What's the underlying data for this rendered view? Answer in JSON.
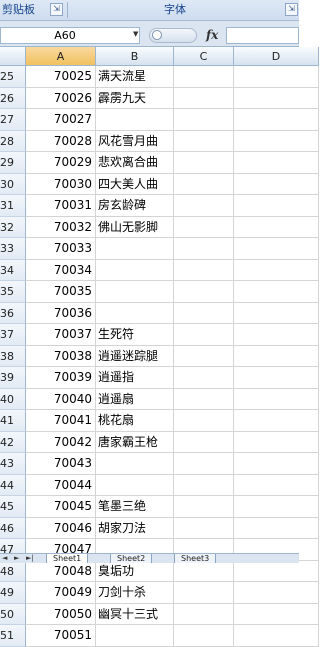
{
  "ribbon": {
    "clipboard_label": "剪贴板",
    "font_label": "字体",
    "launcher_glyph": "⇲"
  },
  "formula_bar": {
    "name_box": "A60",
    "fx": "fx",
    "formula": ""
  },
  "columns": [
    "A",
    "B",
    "C",
    "D"
  ],
  "rows": [
    {
      "n": "25",
      "a": "70025",
      "b": "满天流星"
    },
    {
      "n": "26",
      "a": "70026",
      "b": "霹雳九天"
    },
    {
      "n": "27",
      "a": "70027",
      "b": ""
    },
    {
      "n": "28",
      "a": "70028",
      "b": "风花雪月曲"
    },
    {
      "n": "29",
      "a": "70029",
      "b": "悲欢离合曲"
    },
    {
      "n": "30",
      "a": "70030",
      "b": "四大美人曲"
    },
    {
      "n": "31",
      "a": "70031",
      "b": "房玄龄碑"
    },
    {
      "n": "32",
      "a": "70032",
      "b": "佛山无影脚"
    },
    {
      "n": "33",
      "a": "70033",
      "b": ""
    },
    {
      "n": "34",
      "a": "70034",
      "b": ""
    },
    {
      "n": "35",
      "a": "70035",
      "b": ""
    },
    {
      "n": "36",
      "a": "70036",
      "b": ""
    },
    {
      "n": "37",
      "a": "70037",
      "b": "生死符"
    },
    {
      "n": "38",
      "a": "70038",
      "b": "逍遥迷踪腿"
    },
    {
      "n": "39",
      "a": "70039",
      "b": "逍遥指"
    },
    {
      "n": "40",
      "a": "70040",
      "b": "逍遥扇"
    },
    {
      "n": "41",
      "a": "70041",
      "b": "桃花扇"
    },
    {
      "n": "42",
      "a": "70042",
      "b": "唐家霸王枪"
    },
    {
      "n": "43",
      "a": "70043",
      "b": ""
    },
    {
      "n": "44",
      "a": "70044",
      "b": ""
    },
    {
      "n": "45",
      "a": "70045",
      "b": "笔墨三绝"
    },
    {
      "n": "46",
      "a": "70046",
      "b": "胡家刀法"
    },
    {
      "n": "47",
      "a": "70047",
      "b": ""
    },
    {
      "n": "48",
      "a": "70048",
      "b": "臭垢功"
    },
    {
      "n": "49",
      "a": "70049",
      "b": "刀剑十杀"
    },
    {
      "n": "50",
      "a": "70050",
      "b": "幽冥十三式"
    },
    {
      "n": "51",
      "a": "70051",
      "b": ""
    }
  ],
  "sheet_tabs": {
    "nav": [
      "◄",
      "►",
      "►|"
    ],
    "tabs": [
      "Sheet1",
      "Sheet2",
      "Sheet3"
    ]
  },
  "colors": {
    "ribbon_text": "#15428b",
    "selected_header": "#f1c15f",
    "grid_line": "#d4d4d4"
  }
}
